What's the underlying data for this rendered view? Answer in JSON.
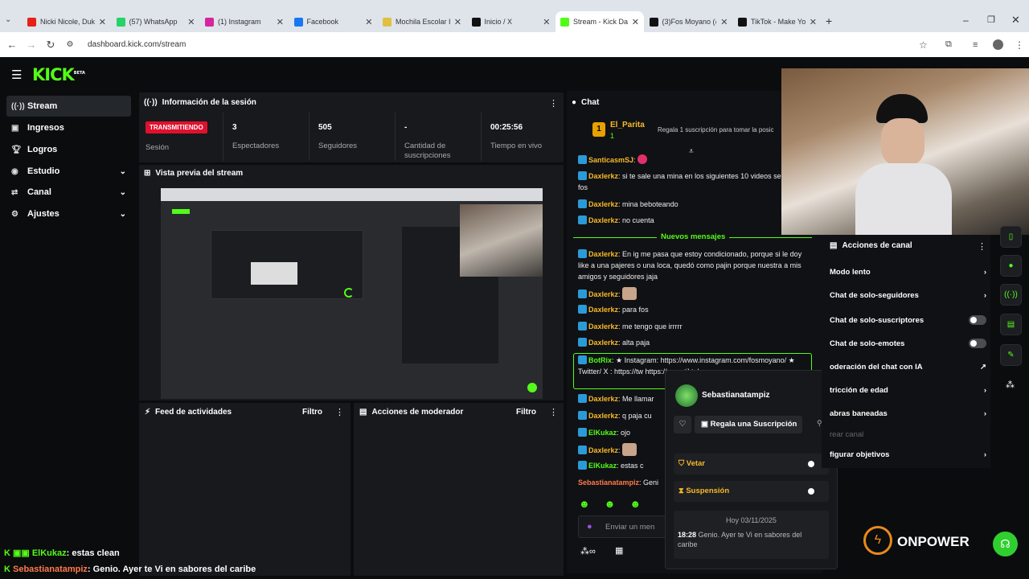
{
  "browser": {
    "tabs": [
      {
        "title": "Nicki Nicole, Duk",
        "color": "#e62117"
      },
      {
        "title": "(57) WhatsApp",
        "color": "#25d366"
      },
      {
        "title": "(1) Instagram",
        "color": "#d6249f"
      },
      {
        "title": "Facebook",
        "color": "#1877f2"
      },
      {
        "title": "Mochila Escolar Ir",
        "color": "#e0c040"
      },
      {
        "title": "Inicio / X",
        "color": "#111111"
      },
      {
        "title": "Stream - Kick Das",
        "color": "#53fc18"
      },
      {
        "title": "(3)Fos Moyano (@",
        "color": "#111111"
      },
      {
        "title": "TikTok - Make You",
        "color": "#111111"
      }
    ],
    "url": "dashboard.kick.com/stream"
  },
  "app": {
    "logo": "KICK",
    "logo_tag": "BETA"
  },
  "sidebar": [
    {
      "label": "Stream",
      "icon": "broadcast-icon"
    },
    {
      "label": "Ingresos",
      "icon": "dollar-icon"
    },
    {
      "label": "Logros",
      "icon": "trophy-icon"
    },
    {
      "label": "Estudio",
      "icon": "studio-icon"
    },
    {
      "label": "Canal",
      "icon": "channel-icon"
    },
    {
      "label": "Ajustes",
      "icon": "gear-icon"
    }
  ],
  "session": {
    "title": "Información de la sesión",
    "live_badge": "TRANSMITIENDO",
    "live_label": "Sesión",
    "stats": [
      {
        "value": "3",
        "label": "Espectadores"
      },
      {
        "value": "505",
        "label": "Seguidores"
      },
      {
        "value": "-",
        "label": "Cantidad de suscripciones"
      },
      {
        "value": "00:25:56",
        "label": "Tiempo en vivo"
      }
    ]
  },
  "preview": {
    "title": "Vista previa del stream"
  },
  "feed": {
    "title": "Feed de actividades",
    "filter": "Filtro"
  },
  "modactions": {
    "title": "Acciones de moderador",
    "filter": "Filtro"
  },
  "chat": {
    "title": "Chat",
    "pinned_user": "El_Parita",
    "pinned_count": "1",
    "pinned_rank": "1",
    "pinned_text": "Regala 1 suscripción para tomar la posic",
    "new_messages": "Nuevos mensajes",
    "input_placeholder": "Enviar un men",
    "messages": [
      {
        "user": "SanticasmSJ",
        "text": ""
      },
      {
        "user": "Daxlerkz",
        "text": "si te sale una mina en los siguientes 10 videos se brava fos"
      },
      {
        "user": "Daxlerkz",
        "text": "mina beboteando"
      },
      {
        "user": "Daxlerkz",
        "text": "no cuenta"
      },
      {
        "user": "Daxlerkz",
        "text": "En ig me pasa que estoy condicionado, porque si le doy like a una pajeres o una loca, quedó como pajin porque nuestra a mis amigos y seguidores jaja"
      },
      {
        "user": "Daxlerkz",
        "text": ""
      },
      {
        "user": "Daxlerkz",
        "text": "para fos"
      },
      {
        "user": "Daxlerkz",
        "text": "me tengo que irrrrr"
      },
      {
        "user": "Daxlerkz",
        "text": "alta paja"
      },
      {
        "user": "BotRix",
        "text": "★ Instagram: https://www.instagram.com/fosmoyano/ ★ Twitter/ X : https://tw https://www.tiktok.com"
      },
      {
        "user": "Daxlerkz",
        "text": "Me llamar"
      },
      {
        "user": "Daxlerkz",
        "text": "q paja cu"
      },
      {
        "user": "ElKukaz",
        "text": "ojo"
      },
      {
        "user": "Daxlerkz",
        "text": ""
      },
      {
        "user": "ElKukaz",
        "text": "estas c"
      },
      {
        "user": "Sebastianatampiz",
        "text": "Geni"
      }
    ]
  },
  "popup": {
    "username": "Sebastianatampiz",
    "gift_label": "Regala una Suscripción",
    "ban_label": "Vetar",
    "timeout_label": "Suspensión",
    "date": "Hoy 03/11/2025",
    "time": "18:28",
    "message": "Genio. Ayer te Vi en sabores del caribe"
  },
  "channel_actions": {
    "title": "Acciones de canal",
    "items": [
      "Modo lento",
      "Chat de solo-seguidores",
      "Chat de solo-suscriptores",
      "Chat de solo-emotes",
      "oderación del chat con IA",
      "tricción de edad",
      "abras baneadas",
      "rear canal",
      "figurar objetivos"
    ]
  },
  "overlay": {
    "line1_user": "ElKukaz",
    "line1_text": ": estas clean",
    "line2_user": "Sebastianatampiz",
    "line2_text": ": Genio. Ayer te Vi en sabores del caribe",
    "sponsor": "ONPOWER"
  }
}
